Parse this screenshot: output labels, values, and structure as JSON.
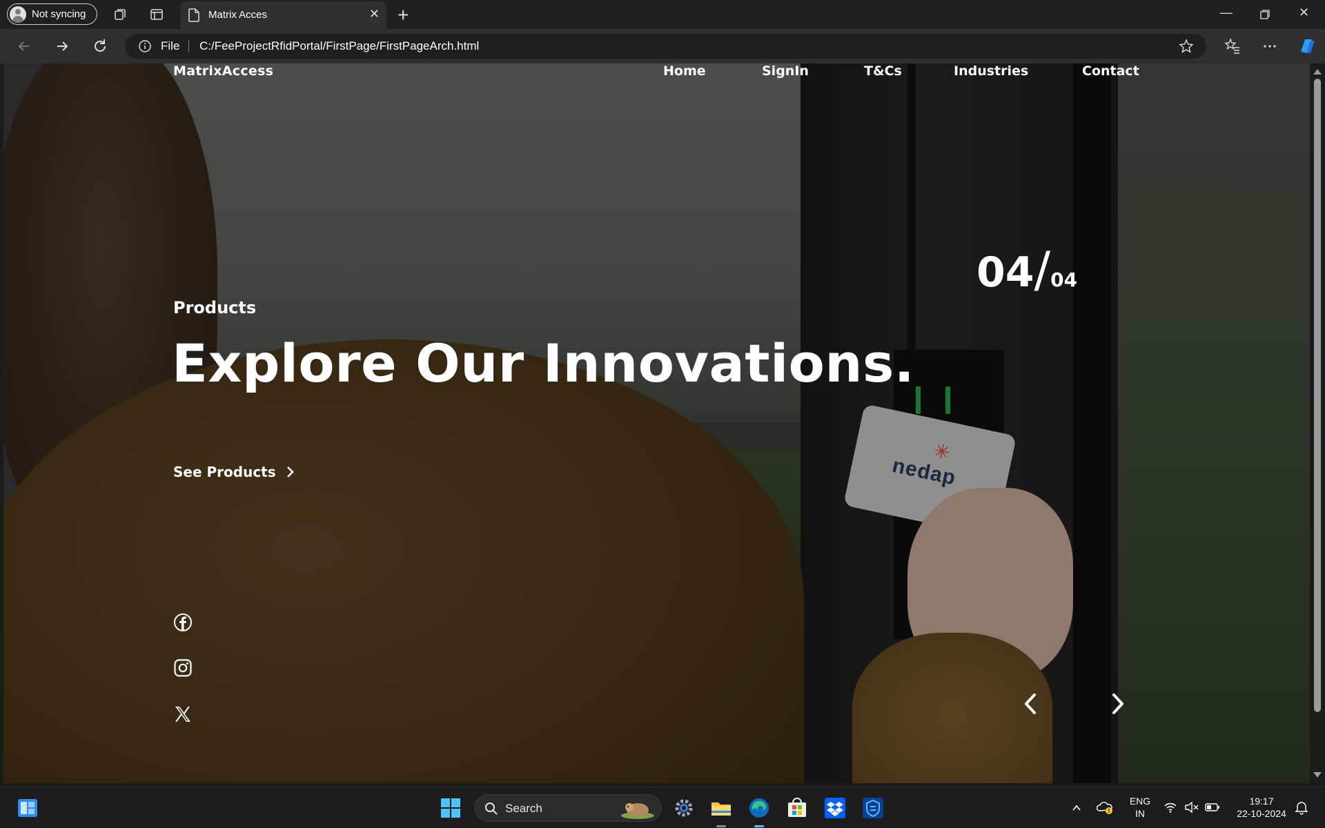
{
  "browser": {
    "profile_label": "Not syncing",
    "tab_title": "Matrix Acces",
    "address_scheme": "File",
    "address_url": "C:/FeeProjectRfidPortal/FirstPage/FirstPageArch.html"
  },
  "site": {
    "brand": "MatrixAccess",
    "nav": [
      "Home",
      "SignIn",
      "T&Cs",
      "Industries",
      "Contact"
    ],
    "eyebrow": "Products",
    "headline": "Explore Our Innovations.",
    "cta_label": "See Products",
    "slide_current": "04",
    "slide_separator": "/",
    "slide_total": "04",
    "card_brand": "nedap"
  },
  "taskbar": {
    "search_label": "Search",
    "lang_top": "ENG",
    "lang_bottom": "IN",
    "time": "19:17",
    "date": "22-10-2024"
  },
  "colors": {
    "edge_blue": "#0f6cbd",
    "windows_blue": "#2d8cf0",
    "folder_yellow": "#f3c23c",
    "dropbox_blue": "#0061fe"
  }
}
